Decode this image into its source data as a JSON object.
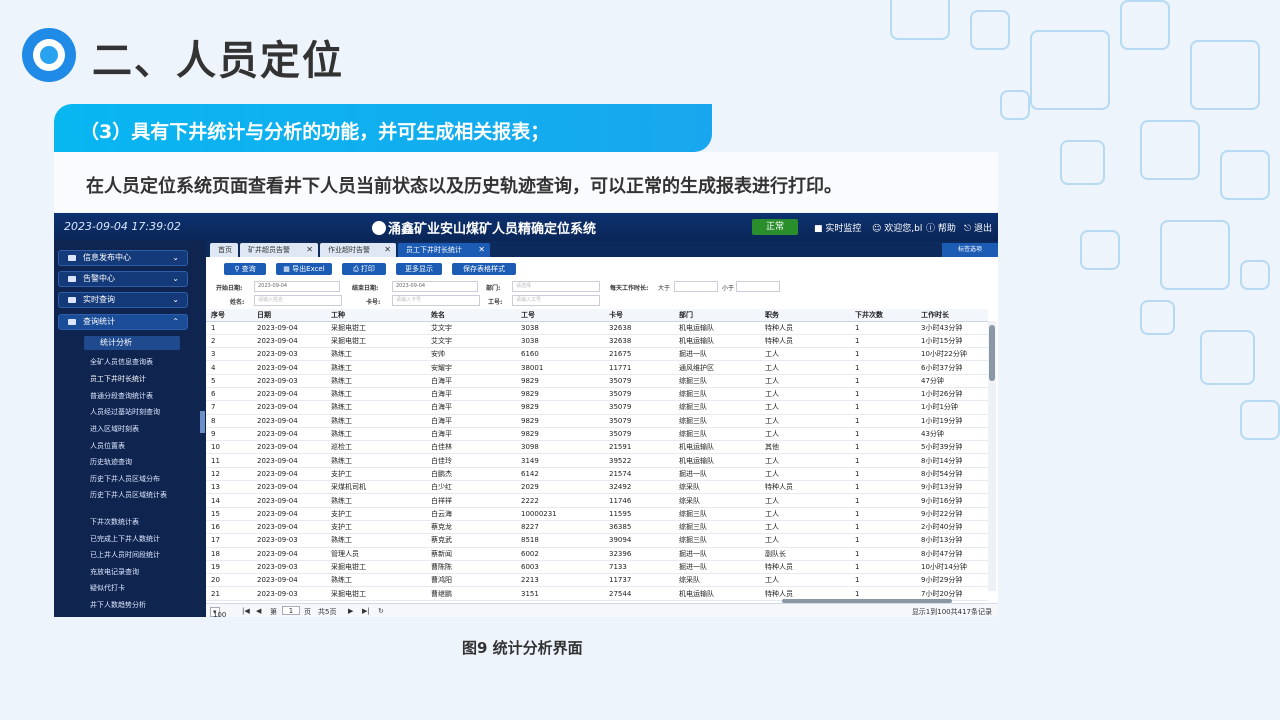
{
  "slide": {
    "title": "二、人员定位",
    "banner": "（3）具有下井统计与分析的功能，并可生成相关报表；",
    "description": "在人员定位系统页面查看井下人员当前状态以及历史轨迹查询，可以正常的生成报表进行打印。",
    "caption": "图9 统计分析界面"
  },
  "app": {
    "datetime": "2023-09-04 17:39:02",
    "title": "涌鑫矿业安山煤矿人员精确定位系统",
    "status": "正常",
    "header_buttons": [
      "实时监控",
      "欢迎您,bl",
      "帮助",
      "退出"
    ]
  },
  "sidebar": {
    "menus": [
      "信息发布中心",
      "告警中心",
      "实时查询",
      "查询统计"
    ],
    "sub_menu": "统计分析",
    "items": [
      "全矿人员信息查询表",
      "员工下井时长统计",
      "普通分段查询统计表",
      "人员经过基站时刻查询",
      "进入区域时刻表",
      "人员位置表",
      "历史轨迹查询",
      "历史下井人员区域分布",
      "历史下井人员区域统计表",
      "下井次数统计表",
      "已完成上下井人数统计",
      "已上井人员时间段统计",
      "充放电记录查询",
      "疑似代打卡",
      "井下人数趋势分析"
    ]
  },
  "tabs": [
    "首页",
    "矿井超员告警",
    "作业超时告警",
    "员工下井时长统计"
  ],
  "tab_option": "标签选项",
  "toolbar": [
    "查询",
    "导出Excel",
    "打印",
    "更多显示",
    "保存表格样式"
  ],
  "filters": {
    "start_date_label": "开始日期:",
    "start_date": "2023-09-04",
    "end_date_label": "结束日期:",
    "end_date": "2023-09-04",
    "dept_label": "部门:",
    "dept_placeholder": "请选择",
    "worktime_label": "每天工作时长:",
    "gt_label": "大于",
    "lt_label": "小于",
    "name_label": "姓名:",
    "name_placeholder": "请输入姓名",
    "card_label": "卡号:",
    "card_placeholder": "请输入卡号",
    "empno_label": "工号:",
    "empno_placeholder": "请输入工号"
  },
  "grid": {
    "columns": [
      "序号",
      "日期",
      "工种",
      "姓名",
      "工号",
      "卡号",
      "部门",
      "职务",
      "下井次数",
      "工作时长"
    ],
    "rows": [
      [
        "1",
        "2023-09-04",
        "采掘电钳工",
        "艾文宇",
        "3038",
        "32638",
        "机电运输队",
        "特种人员",
        "1",
        "3小时43分钟"
      ],
      [
        "2",
        "2023-09-04",
        "采掘电钳工",
        "艾文宇",
        "3038",
        "32638",
        "机电运输队",
        "特种人员",
        "1",
        "1小时15分钟"
      ],
      [
        "3",
        "2023-09-03",
        "熟练工",
        "安帅",
        "6160",
        "21675",
        "掘进一队",
        "工人",
        "1",
        "10小时22分钟"
      ],
      [
        "4",
        "2023-09-04",
        "熟练工",
        "安耀宇",
        "38001",
        "11771",
        "通风维护区",
        "工人",
        "1",
        "6小时37分钟"
      ],
      [
        "5",
        "2023-09-03",
        "熟练工",
        "白海平",
        "9829",
        "35079",
        "综掘三队",
        "工人",
        "1",
        "47分钟"
      ],
      [
        "6",
        "2023-09-04",
        "熟练工",
        "白海平",
        "9829",
        "35079",
        "综掘三队",
        "工人",
        "1",
        "1小时26分钟"
      ],
      [
        "7",
        "2023-09-04",
        "熟练工",
        "白海平",
        "9829",
        "35079",
        "综掘三队",
        "工人",
        "1",
        "1小时1分钟"
      ],
      [
        "8",
        "2023-09-04",
        "熟练工",
        "白海平",
        "9829",
        "35079",
        "综掘三队",
        "工人",
        "1",
        "1小时19分钟"
      ],
      [
        "9",
        "2023-09-04",
        "熟练工",
        "白海平",
        "9829",
        "35079",
        "综掘三队",
        "工人",
        "1",
        "43分钟"
      ],
      [
        "10",
        "2023-09-04",
        "巡检工",
        "白佳林",
        "3098",
        "21591",
        "机电运输队",
        "其他",
        "1",
        "5小时39分钟"
      ],
      [
        "11",
        "2023-09-04",
        "熟练工",
        "白佳玲",
        "3149",
        "39522",
        "机电运输队",
        "工人",
        "1",
        "8小时14分钟"
      ],
      [
        "12",
        "2023-09-04",
        "支护工",
        "白鹏杰",
        "6142",
        "21574",
        "掘进一队",
        "工人",
        "1",
        "8小时54分钟"
      ],
      [
        "13",
        "2023-09-04",
        "采煤机司机",
        "白少红",
        "2029",
        "32492",
        "综采队",
        "特种人员",
        "1",
        "9小时13分钟"
      ],
      [
        "14",
        "2023-09-04",
        "熟练工",
        "白祥祥",
        "2222",
        "11746",
        "综采队",
        "工人",
        "1",
        "9小时16分钟"
      ],
      [
        "15",
        "2023-09-04",
        "支护工",
        "白云海",
        "10000231",
        "11595",
        "综掘三队",
        "工人",
        "1",
        "9小时22分钟"
      ],
      [
        "16",
        "2023-09-04",
        "支护工",
        "蔡克龙",
        "8227",
        "36385",
        "综掘三队",
        "工人",
        "1",
        "2小时40分钟"
      ],
      [
        "17",
        "2023-09-03",
        "熟练工",
        "蔡克武",
        "8518",
        "39094",
        "综掘三队",
        "工人",
        "1",
        "8小时13分钟"
      ],
      [
        "18",
        "2023-09-04",
        "管理人员",
        "蔡新闻",
        "6002",
        "32396",
        "掘进一队",
        "副队长",
        "1",
        "8小时47分钟"
      ],
      [
        "19",
        "2023-09-03",
        "采掘电钳工",
        "曹陈陈",
        "6003",
        "7133",
        "掘进一队",
        "特种人员",
        "1",
        "10小时14分钟"
      ],
      [
        "20",
        "2023-09-04",
        "熟练工",
        "曹鸿阳",
        "2213",
        "11737",
        "综采队",
        "工人",
        "1",
        "9小时29分钟"
      ],
      [
        "21",
        "2023-09-03",
        "采掘电钳工",
        "曹继鹏",
        "3151",
        "27544",
        "机电运输队",
        "特种人员",
        "1",
        "7小时20分钟"
      ]
    ]
  },
  "pager": {
    "page_size": "100",
    "page_label": "第",
    "page_value": "1",
    "page_unit": "页",
    "total_pages": "共5页",
    "summary": "显示1到100共417条记录"
  }
}
